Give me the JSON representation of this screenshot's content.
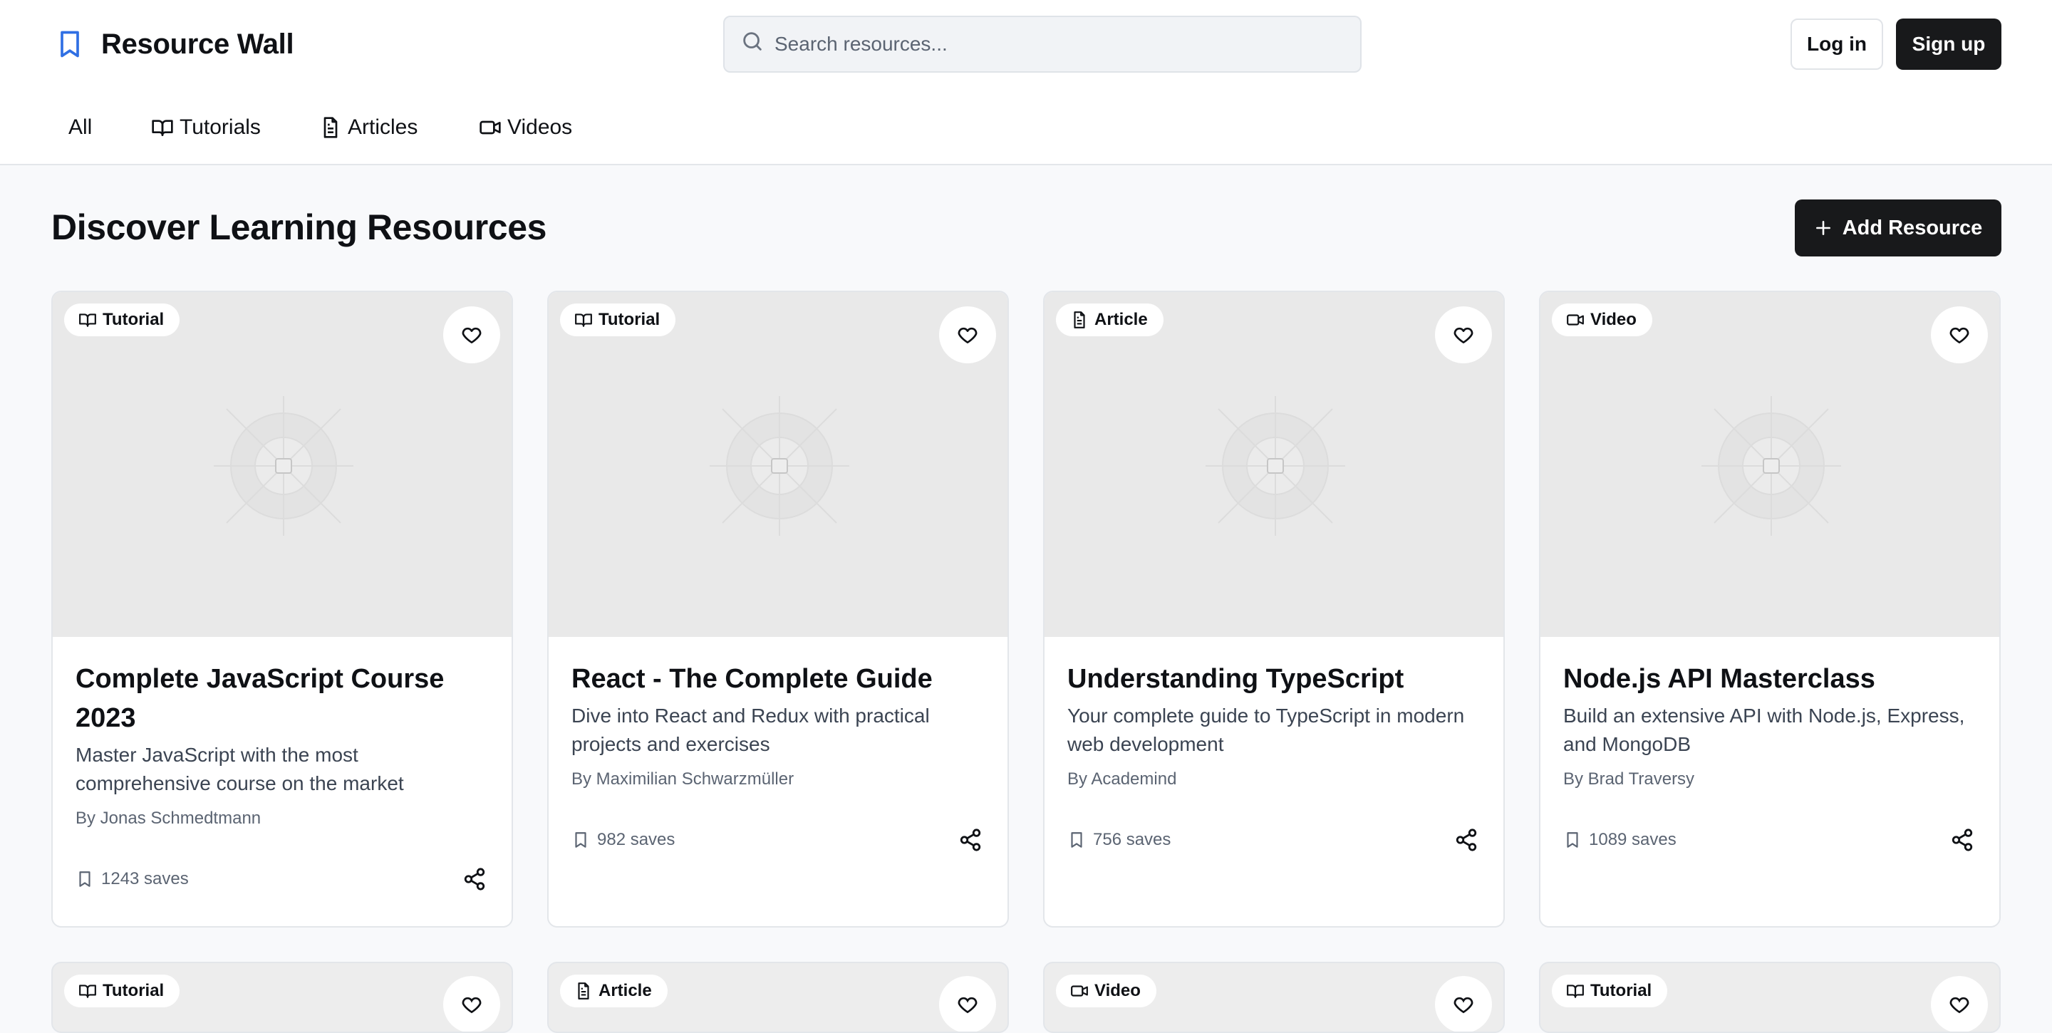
{
  "app": {
    "title": "Resource Wall"
  },
  "header": {
    "search_placeholder": "Search resources...",
    "login_label": "Log in",
    "signup_label": "Sign up"
  },
  "nav": {
    "items": [
      {
        "label": "All",
        "icon": "none"
      },
      {
        "label": "Tutorials",
        "icon": "book-open-icon"
      },
      {
        "label": "Articles",
        "icon": "file-text-icon"
      },
      {
        "label": "Videos",
        "icon": "video-icon"
      }
    ]
  },
  "page": {
    "title": "Discover Learning Resources",
    "add_label": "Add Resource"
  },
  "cards": [
    {
      "type": "Tutorial",
      "title": "Complete JavaScript Course 2023",
      "description": "Master JavaScript with the most comprehensive course on the market",
      "author": "By Jonas Schmedtmann",
      "saves": "1243 saves"
    },
    {
      "type": "Tutorial",
      "title": "React - The Complete Guide",
      "description": "Dive into React and Redux with practical projects and exercises",
      "author": "By Maximilian Schwarzmüller",
      "saves": "982 saves"
    },
    {
      "type": "Article",
      "title": "Understanding TypeScript",
      "description": "Your complete guide to TypeScript in modern web development",
      "author": "By Academind",
      "saves": "756 saves"
    },
    {
      "type": "Video",
      "title": "Node.js API Masterclass",
      "description": "Build an extensive API with Node.js, Express, and MongoDB",
      "author": "By Brad Traversy",
      "saves": "1089 saves"
    }
  ],
  "cards_row2": [
    {
      "type": "Tutorial"
    },
    {
      "type": "Article"
    },
    {
      "type": "Video"
    },
    {
      "type": "Tutorial"
    }
  ],
  "colors": {
    "accent": "#2f6fe4",
    "primary_button": "#18191b",
    "background": "#f8f9fb",
    "media_placeholder": "#e9e9e9"
  }
}
